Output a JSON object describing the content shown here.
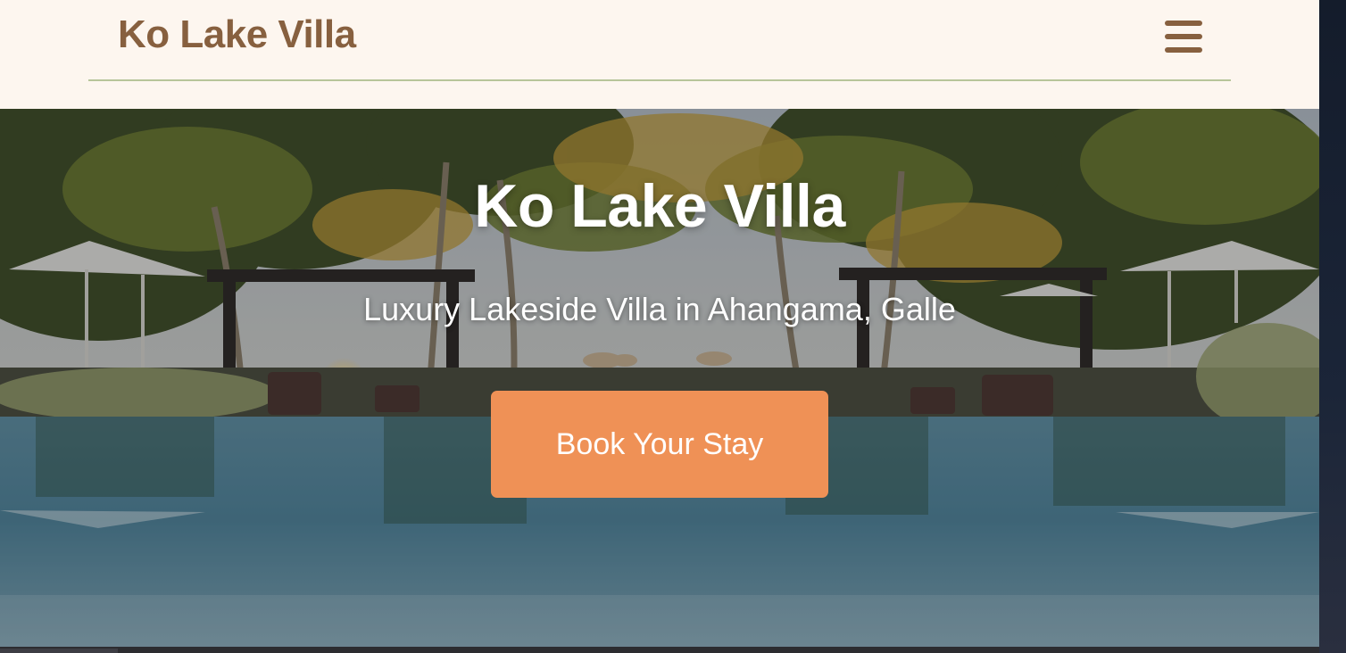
{
  "header": {
    "logo_text": "Ko Lake Villa",
    "menu_icon": "hamburger-menu-icon"
  },
  "hero": {
    "title": "Ko Lake Villa",
    "subtitle": "Luxury Lakeside Villa in Ahangama, Galle",
    "cta_label": "Book Your Stay",
    "background": "resort infinity pool with palm trees, cabanas and white parasols"
  },
  "colors": {
    "brand_brown": "#87603f",
    "header_bg": "#fdf6ef",
    "divider_green": "#b7c59a",
    "cta_orange": "#ef9156",
    "hero_text": "#ffffff"
  }
}
